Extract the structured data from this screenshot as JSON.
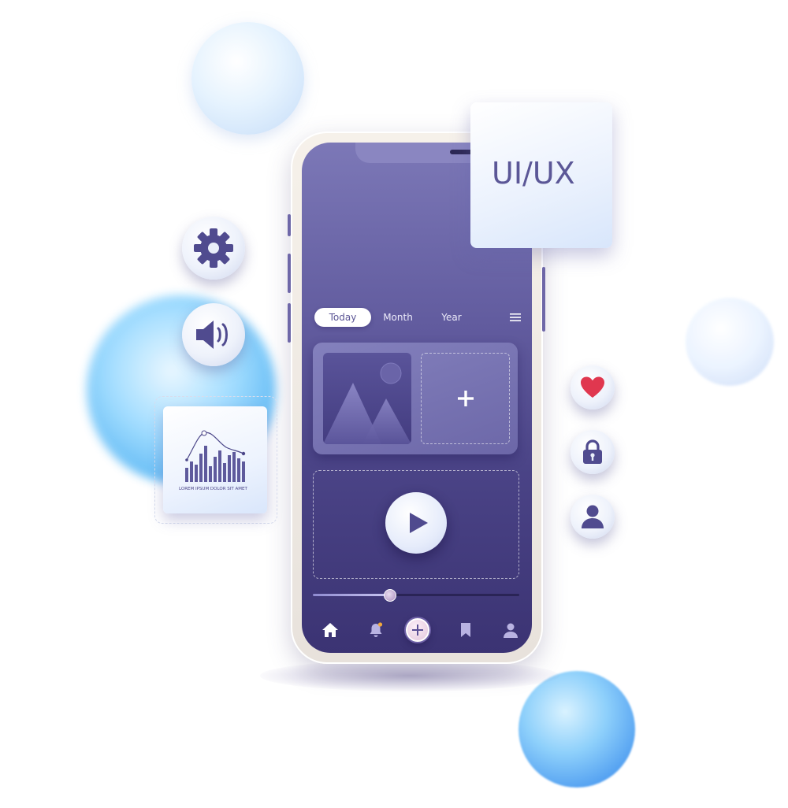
{
  "uiux_card": {
    "text": "UI/UX"
  },
  "chart_card": {
    "caption": "LOREM IPSUM DOLOR SIT AMET"
  },
  "app": {
    "tabs": [
      {
        "label": "Today",
        "active": true
      },
      {
        "label": "Month",
        "active": false
      },
      {
        "label": "Year",
        "active": false
      }
    ],
    "player": {
      "progress": 0.37
    },
    "nav": [
      {
        "icon": "home-icon",
        "active": true
      },
      {
        "icon": "bell-icon",
        "notification_dot": true
      },
      {
        "icon": "plus-icon"
      },
      {
        "icon": "bookmark-icon"
      },
      {
        "icon": "user-icon"
      }
    ]
  },
  "colors": {
    "screen_top": "#7c78b7",
    "screen_bottom": "#3b3373",
    "accent_text": "#5b5797",
    "heart": "#e0374f",
    "notification": "#f2a93b"
  }
}
